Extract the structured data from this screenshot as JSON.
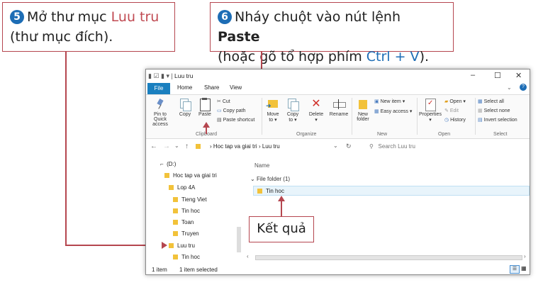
{
  "step5": {
    "number": "5",
    "line1": "Mở thư mục ",
    "folder": "Luu tru",
    "line2": "(thư mục đích)."
  },
  "step6": {
    "number": "6",
    "line1": "Nháy chuột vào nút lệnh ",
    "cmd": "Paste",
    "line2_pre": "(hoặc gõ tổ hợp phím ",
    "keys": "Ctrl + V",
    "line2_post": ")."
  },
  "window": {
    "title": "Luu tru",
    "tabs": {
      "file": "File",
      "home": "Home",
      "share": "Share",
      "view": "View"
    },
    "ribbon": {
      "pin": "Pin to Quick access",
      "copy": "Copy",
      "paste": "Paste",
      "cut": "Cut",
      "copy_path": "Copy path",
      "paste_shortcut": "Paste shortcut",
      "move_to": "Move to",
      "copy_to": "Copy to",
      "delete": "Delete",
      "rename": "Rename",
      "new_folder": "New folder",
      "new_item": "New item",
      "easy_access": "Easy access",
      "properties": "Properties",
      "open": "Open",
      "edit": "Edit",
      "history": "History",
      "select_all": "Select all",
      "select_none": "Select none",
      "invert_selection": "Invert selection",
      "groups": {
        "clipboard": "Clipboard",
        "organize": "Organize",
        "new": "New",
        "open": "Open",
        "select": "Select"
      }
    },
    "path": {
      "part1": "Hoc tap va giai tri",
      "sep": "›",
      "part2": "Luu tru"
    },
    "search_placeholder": "Search Luu tru",
    "tree": [
      "(D:)",
      "Hoc tap va giai tri",
      "Lop 4A",
      "Tieng Viet",
      "Tin hoc",
      "Toan",
      "Truyen",
      "Luu tru",
      "Tin hoc"
    ],
    "column_name": "Name",
    "group_header": "File folder (1)",
    "file_item": "Tin hoc",
    "status": {
      "count": "1 item",
      "selected": "1 item selected"
    }
  },
  "result_label": "Kết quả"
}
